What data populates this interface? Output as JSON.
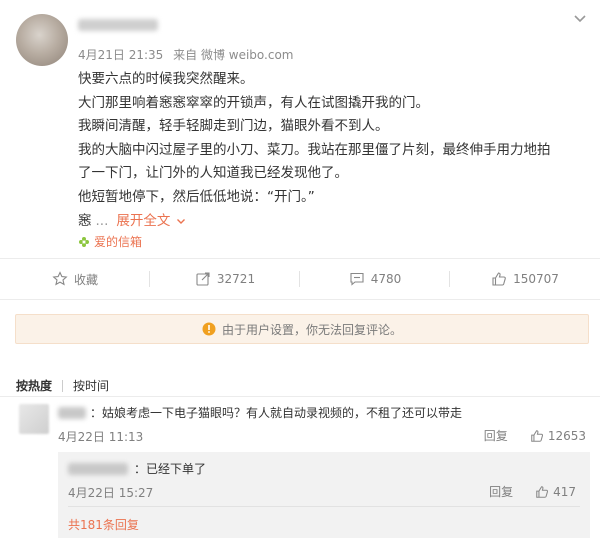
{
  "post": {
    "meta_date": "4月21日 21:35",
    "meta_source": "来自 微博 weibo.com",
    "lines": [
      "快要六点的时候我突然醒来。",
      "大门那里响着窸窸窣窣的开锁声，有人在试图撬开我的门。",
      "我瞬间清醒，轻手轻脚走到门边，猫眼外看不到人。",
      "我的大脑中闪过屋子里的小刀、菜刀。我站在那里僵了片刻，最终伸手用力地拍",
      "了一下门，让门外的人知道我已经发现他了。",
      "他短暂地停下，然后低低地说：“开门。”"
    ],
    "truncated_text": "窸",
    "expand_label": "展开全文",
    "tag_label": "爱的信箱"
  },
  "actions": {
    "favorite_label": "收藏",
    "repost_count": "32721",
    "comment_count": "4780",
    "like_count": "150707"
  },
  "notice_text": "由于用户设置，你无法回复评论。",
  "sort": {
    "hot_label": "按热度",
    "time_label": "按时间"
  },
  "comment": {
    "text": "：姑娘考虑一下电子猫眼吗？有人就自动录视频的，不租了还可以带走",
    "date": "4月22日 11:13",
    "reply_label": "回复",
    "like_count": "12653"
  },
  "reply": {
    "text": "：已经下单了",
    "date": "4月22日 15:27",
    "reply_label": "回复",
    "like_count": "417",
    "total_label": "共181条回复"
  },
  "colors": {
    "accent": "#eb7350",
    "notice_bg": "#fbf2e8",
    "notice_icon": "#f0a020"
  }
}
